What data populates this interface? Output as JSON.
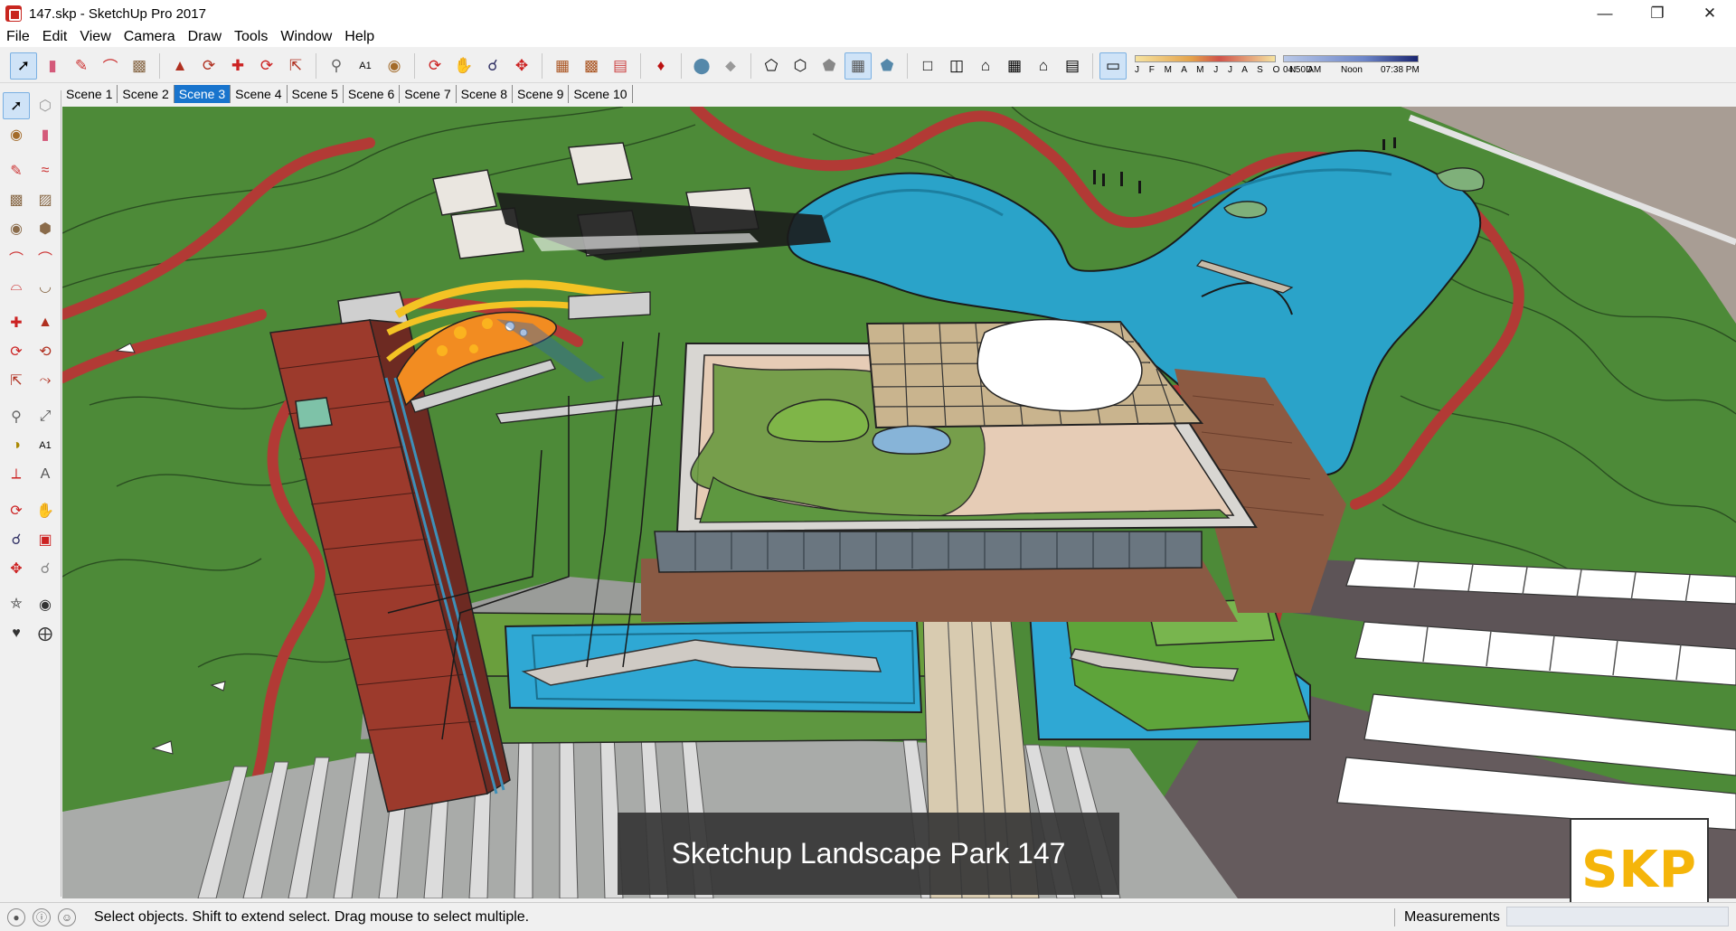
{
  "window": {
    "title": "147.skp - SketchUp Pro 2017",
    "controls": [
      "minimize-icon",
      "maximize-icon",
      "close-icon"
    ]
  },
  "menu": [
    "File",
    "Edit",
    "View",
    "Camera",
    "Draw",
    "Tools",
    "Window",
    "Help"
  ],
  "toolbar": {
    "groups": [
      [
        "select-icon",
        "eraser-icon",
        "pencil-icon",
        "arc-icon",
        "rectangle-icon"
      ],
      [
        "push-pull-icon",
        "follow-me-icon",
        "move-icon",
        "rotate-icon",
        "scale-icon"
      ],
      [
        "tape-measure-icon",
        "text-icon",
        "paint-bucket-icon"
      ],
      [
        "orbit-icon",
        "pan-icon",
        "zoom-icon",
        "zoom-extents-icon"
      ],
      [
        "3d-warehouse-icon",
        "extension-warehouse-icon",
        "layout-icon"
      ],
      [
        "ruby-icon"
      ],
      [
        "x-ray-icon",
        "back-edges-icon"
      ],
      [
        "wireframe-icon",
        "hidden-line-icon",
        "shaded-icon",
        "shaded-textures-icon",
        "monochrome-icon"
      ],
      [
        "iso-view-icon",
        "top-view-icon",
        "front-view-icon",
        "right-view-icon",
        "back-view-icon",
        "left-view-icon"
      ],
      [
        "shadows-icon"
      ]
    ],
    "shadow_months": "J F M A M J J A S O N D",
    "time_start": "04:50 AM",
    "time_noon": "Noon",
    "time_end": "07:38 PM"
  },
  "scenes": {
    "tabs": [
      "Scene 1",
      "Scene 2",
      "Scene 3",
      "Scene 4",
      "Scene 5",
      "Scene 6",
      "Scene 7",
      "Scene 8",
      "Scene 9",
      "Scene 10"
    ],
    "active": "Scene 3"
  },
  "left_tools": [
    "select-icon",
    "make-component-icon",
    "paint-bucket-icon",
    "eraser-icon",
    "line-icon",
    "freehand-icon",
    "rectangle-icon",
    "rotated-rectangle-icon",
    "circle-icon",
    "polygon-icon",
    "arc-icon",
    "two-point-arc-icon",
    "three-point-arc-icon",
    "pie-icon",
    "move-icon",
    "push-pull-icon",
    "rotate-icon",
    "follow-me-icon",
    "scale-icon",
    "offset-icon",
    "tape-measure-icon",
    "dimension-icon",
    "protractor-icon",
    "text-icon",
    "axes-icon",
    "3d-text-icon",
    "orbit-icon",
    "pan-icon",
    "zoom-icon",
    "zoom-window-icon",
    "zoom-extents-icon",
    "previous-view-icon",
    "position-camera-icon",
    "look-around-icon",
    "walk-icon",
    "section-plane-icon"
  ],
  "viewport": {
    "caption": "Sketchup Landscape Park 147",
    "logo": "SKP"
  },
  "status": {
    "message": "Select objects. Shift to extend select. Drag mouse to select multiple.",
    "measurements_label": "Measurements",
    "measurements_value": ""
  }
}
